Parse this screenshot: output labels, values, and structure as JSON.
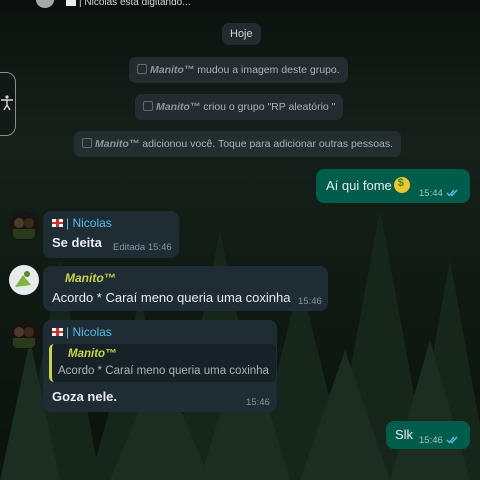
{
  "header": {
    "typing_status": "| Nicolas está digitando..."
  },
  "date_separator": "Hoje",
  "system_messages": [
    {
      "name": "Manito™",
      "text": " mudou a imagem deste grupo."
    },
    {
      "name": "Manito™",
      "text": " criou o grupo \"RP aleatório \""
    },
    {
      "name": "Manito™",
      "text": " adicionou você. Toque para adicionar outras pessoas."
    }
  ],
  "messages": [
    {
      "direction": "out",
      "text": "Aí qui fome",
      "emoji": "money-mouth-face",
      "time": "15:44"
    },
    {
      "direction": "in",
      "sender": "| Nicolas",
      "text": "Se deita",
      "edited": "Editada",
      "time": "15:46"
    },
    {
      "direction": "in",
      "sender": "Manito™",
      "text": "Acordo * Caraí meno queria uma coxinha",
      "time": "15:46"
    },
    {
      "direction": "in",
      "sender": "| Nicolas",
      "quote_name": "Manito™",
      "quote_text": "Acordo * Caraí meno queria uma coxinha",
      "text": "Goza nele.",
      "time": "15:46"
    },
    {
      "direction": "out",
      "text": "Slk",
      "time": "15:46"
    }
  ],
  "colors": {
    "incoming_bubble": "#1f2c33",
    "outgoing_bubble": "#005c4b",
    "sender_nicolas": "#53bdeb",
    "sender_manito": "#c8d44a",
    "read_ticks": "#53bdeb"
  }
}
